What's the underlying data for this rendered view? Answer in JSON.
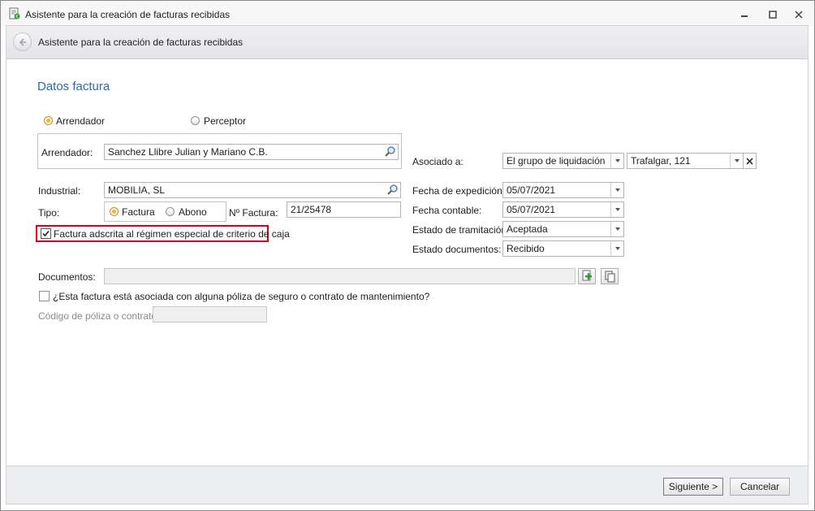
{
  "window": {
    "title": "Asistente para la creación de facturas recibidas",
    "minimize_icon": "minimize-icon",
    "maximize_icon": "maximize-icon",
    "close_icon": "close-icon"
  },
  "header": {
    "title": "Asistente para la creación de facturas recibidas",
    "back_icon": "back-arrow-icon"
  },
  "section": {
    "title": "Datos factura"
  },
  "role_radio": {
    "options": [
      {
        "label": "Arrendador",
        "selected": true
      },
      {
        "label": "Perceptor",
        "selected": false
      }
    ]
  },
  "arrendador": {
    "label": "Arrendador:",
    "value": "Sanchez Llibre Julian y Mariano C.B."
  },
  "industrial": {
    "label": "Industrial:",
    "value": "MOBILIA, SL"
  },
  "tipo": {
    "label": "Tipo:",
    "options": [
      {
        "label": "Factura",
        "selected": true
      },
      {
        "label": "Abono",
        "selected": false
      }
    ]
  },
  "numero_factura": {
    "label": "Nº Factura:",
    "value": "21/25478"
  },
  "criterio_caja": {
    "label": "Factura adscrita al régimen especial de criterio de caja",
    "checked": true
  },
  "asociado": {
    "label": "Asociado a:",
    "type_value": "El grupo de liquidación",
    "target_value": "Trafalgar, 121"
  },
  "fecha_expedicion": {
    "label": "Fecha de expedición:",
    "value": "05/07/2021"
  },
  "fecha_contable": {
    "label": "Fecha contable:",
    "value": "05/07/2021"
  },
  "estado_tramitacion": {
    "label": "Estado de tramitación:",
    "value": "Aceptada"
  },
  "estado_documentos": {
    "label": "Estado documentos:",
    "value": "Recibido"
  },
  "documentos": {
    "label": "Documentos:",
    "value": ""
  },
  "poliza_check": {
    "label": "¿Esta factura está asociada con alguna póliza de seguro o contrato de mantenimiento?",
    "checked": false
  },
  "codigo_poliza": {
    "label": "Código de póliza o contrato:",
    "value": ""
  },
  "footer": {
    "next_label": "Siguiente >",
    "cancel_label": "Cancelar"
  },
  "colors": {
    "accent": "#2a6bb0",
    "highlight_border": "#d6001c",
    "radio_selected": "#f6b13b"
  }
}
